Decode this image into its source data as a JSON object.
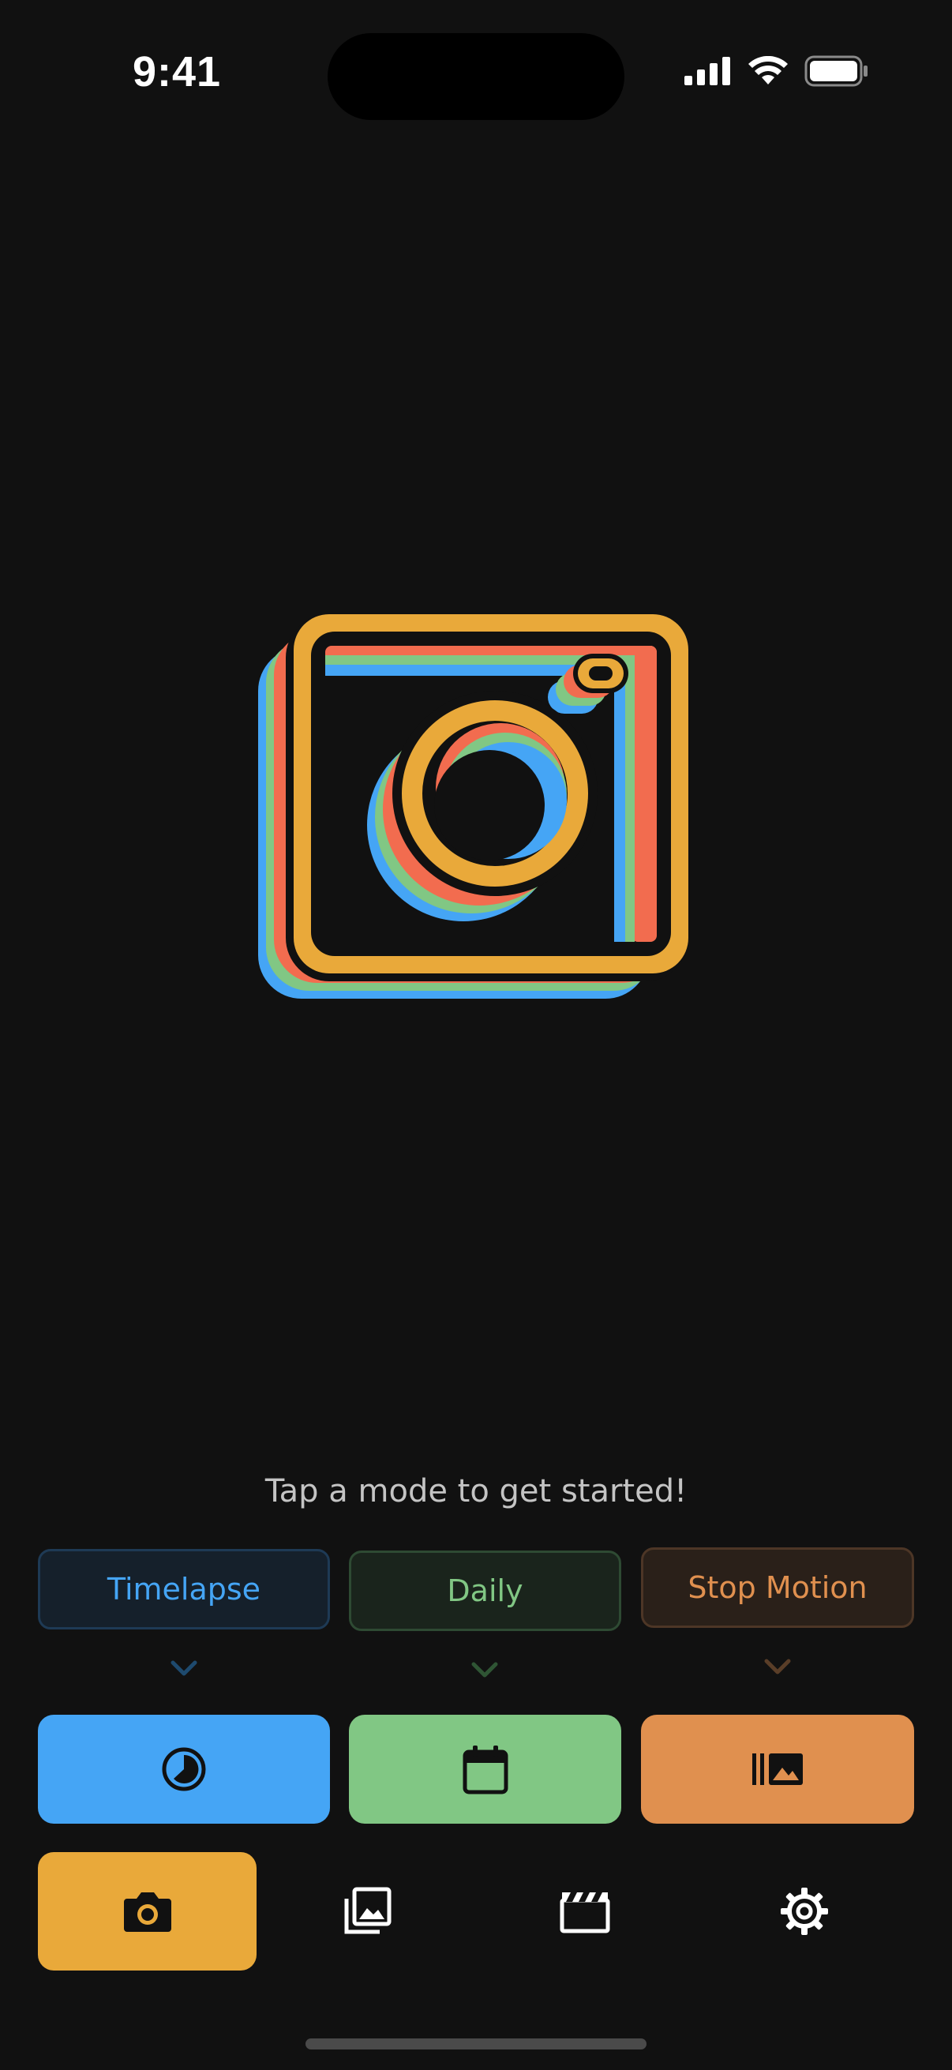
{
  "status_bar": {
    "time": "9:41"
  },
  "hint": "Tap a mode to get started!",
  "modes": [
    {
      "label": "Timelapse",
      "icon": "timelapse-icon",
      "color": "#45a5f5"
    },
    {
      "label": "Daily",
      "icon": "calendar-icon",
      "color": "#81c784"
    },
    {
      "label": "Stop Motion",
      "icon": "stop-motion-icon",
      "color": "#e0904f"
    }
  ],
  "nav": [
    {
      "icon": "camera-icon",
      "selected": true,
      "color": "#e9a93a"
    },
    {
      "icon": "gallery-icon",
      "selected": false
    },
    {
      "icon": "movie-clapper-icon",
      "selected": false
    },
    {
      "icon": "gear-icon",
      "selected": false
    }
  ],
  "colors": {
    "background": "#111111",
    "logo_orange": "#e9a93a",
    "logo_red": "#f26c4f",
    "logo_green": "#81c784",
    "logo_blue": "#45a5f5"
  }
}
